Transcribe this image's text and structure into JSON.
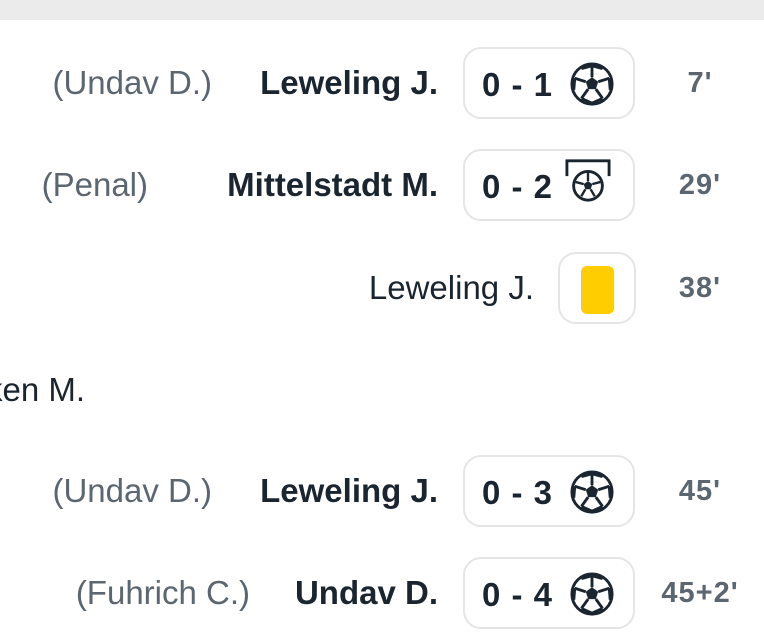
{
  "events": [
    {
      "assist": "(Undav D.)",
      "player": "Leweling J.",
      "score": "0 - 1",
      "icon": "soccer-ball-icon",
      "minute": "7'"
    },
    {
      "assist": "(Penal)",
      "player": "Mittelstadt M.",
      "score": "0 - 2",
      "icon": "penalty-goal-icon",
      "minute": "29'"
    },
    {
      "player": "Leweling J.",
      "icon": "yellow-card-icon",
      "minute": "38'"
    },
    {
      "partial_text": "ken M."
    },
    {
      "assist": "(Undav D.)",
      "player": "Leweling J.",
      "score": "0 - 3",
      "icon": "soccer-ball-icon",
      "minute": "45'"
    },
    {
      "assist": "(Fuhrich C.)",
      "player": "Undav D.",
      "score": "0 - 4",
      "icon": "soccer-ball-icon",
      "minute": "45+2'"
    }
  ],
  "colors": {
    "yellow_card": "#ffcd00",
    "text_dark": "#1a2530",
    "text_muted": "#5b6670",
    "badge_border": "#e3e5e7",
    "top_bar": "#ebebeb"
  }
}
